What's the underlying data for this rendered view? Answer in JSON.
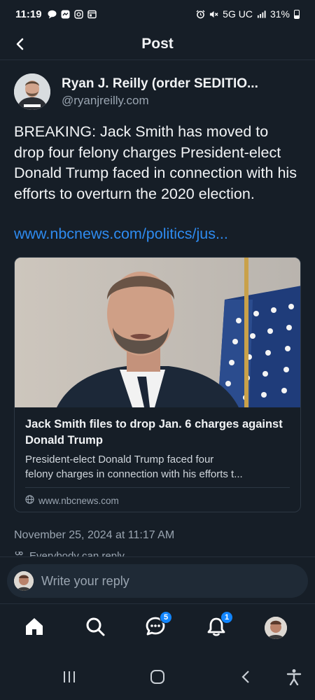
{
  "status_bar": {
    "time": "11:19",
    "network": "5G UC",
    "battery": "31%",
    "left_icons": [
      "chat-icon",
      "messenger-icon",
      "instagram-icon",
      "gallery-icon"
    ],
    "right_icons": [
      "alarm-icon",
      "mute-icon",
      "signal-icon",
      "battery-icon"
    ]
  },
  "header": {
    "title": "Post",
    "back_icon": "back-arrow-icon"
  },
  "post": {
    "author_name": "Ryan J. Reilly (order SEDITIO...",
    "handle": "@ryanjreilly.com",
    "text": "BREAKING: Jack Smith has moved to drop four felony charges President-elect Donald Trump faced in connection with his efforts to overturn the 2020 election.",
    "link": "www.nbcnews.com/politics/jus...",
    "card": {
      "title": "Jack Smith files to drop Jan. 6 charges against Donald Trump",
      "description": "President-elect Donald Trump faced four\nfelony charges in connection with his efforts t...",
      "domain": "www.nbcnews.com",
      "domain_icon": "globe-icon"
    },
    "timestamp": "November 25, 2024 at 11:17 AM",
    "reply_setting": "Everybody can reply"
  },
  "composer": {
    "placeholder": "Write your reply"
  },
  "bottom_nav": {
    "items": [
      {
        "name": "home",
        "icon": "home-icon"
      },
      {
        "name": "search",
        "icon": "search-icon"
      },
      {
        "name": "chat",
        "icon": "chat-bubble-icon",
        "badge": "5"
      },
      {
        "name": "notifications",
        "icon": "bell-icon",
        "badge": "1"
      },
      {
        "name": "profile",
        "icon": "avatar"
      }
    ]
  },
  "system_nav": [
    "recents-icon",
    "home-circle-icon",
    "back-chevron-icon",
    "accessibility-icon"
  ],
  "colors": {
    "background": "#161e27",
    "link": "#2e8bf0",
    "badge": "#1185fe",
    "muted": "#9aa5b1"
  }
}
